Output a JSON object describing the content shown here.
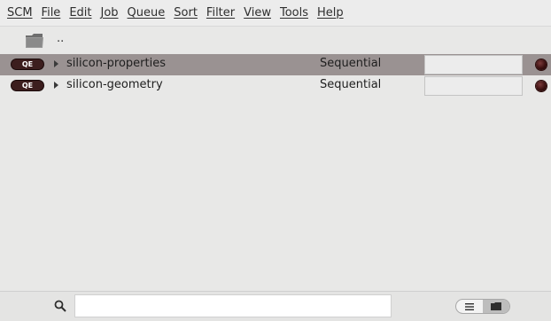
{
  "menu": {
    "items": [
      "SCM",
      "File",
      "Edit",
      "Job",
      "Queue",
      "Sort",
      "Filter",
      "View",
      "Tools",
      "Help"
    ]
  },
  "list": {
    "parent_label": "..",
    "rows": [
      {
        "badge": "QE",
        "name": "silicon-properties",
        "mode": "Sequential",
        "field_value": "",
        "selected": true,
        "status_color": "#3a1010"
      },
      {
        "badge": "QE",
        "name": "silicon-geometry",
        "mode": "Sequential",
        "field_value": "",
        "selected": false,
        "status_color": "#3a1010"
      }
    ]
  },
  "bottom": {
    "search_value": "",
    "search_placeholder": "",
    "view_modes": [
      "list-view-icon",
      "folder-view-icon"
    ],
    "active_view": "folder-view-icon"
  },
  "colors": {
    "selected_row": "#9a9292",
    "badge_bg": "#3c1e1e",
    "background": "#e8e8e7"
  }
}
